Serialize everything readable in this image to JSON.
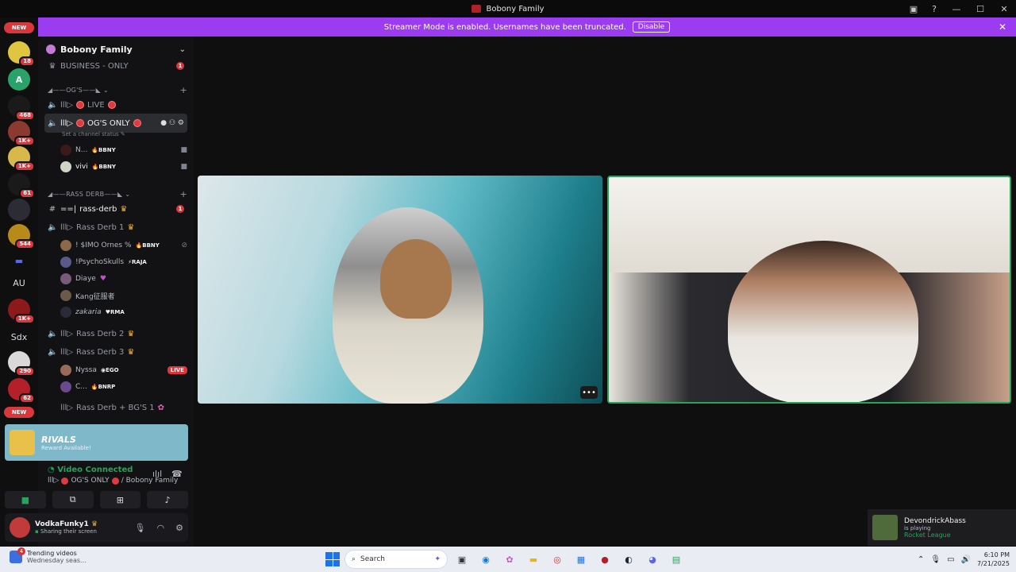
{
  "window": {
    "title": "Bobony Family"
  },
  "banner": {
    "text": "Streamer Mode is enabled. Usernames have been truncated.",
    "disable_label": "Disable"
  },
  "rail": {
    "new_top": "NEW",
    "new_bottom": "NEW",
    "badges": [
      "18",
      "468",
      "1K+",
      "1K+",
      "61",
      "544",
      "1K+",
      "290",
      "62"
    ],
    "text_servers": [
      "AU",
      "Sdx"
    ]
  },
  "server": {
    "name": "Bobony Family"
  },
  "channels": {
    "business": "BUSINESS - ONLY",
    "business_badge": "1",
    "cat_ogs": "OG'S",
    "live": "LIVE",
    "ogs_only": "OG'S ONLY",
    "set_status": "Set a channel status",
    "cat_rass": "RASS DERB",
    "rass_derb_text": "rass-derb",
    "rass_badge": "1",
    "rass1": "Rass Derb 1",
    "rass2": "Rass Derb 2",
    "rass3": "Rass Derb 3",
    "rass_bgs": "Rass Derb + BG'S 1"
  },
  "voice_users": [
    {
      "name": "N...",
      "tag": "BBNY"
    },
    {
      "name": "vivi",
      "tag": "BBNY"
    },
    {
      "name": "! $IMO Ornes %",
      "tag": "BBNY"
    },
    {
      "name": "!PsychoSkulls",
      "tag": "RAJA"
    },
    {
      "name": "Diaye",
      "tag": ""
    },
    {
      "name": "Kang征服者",
      "tag": ""
    },
    {
      "name": "zakaria",
      "tag": "RMA"
    },
    {
      "name": "Nyssa",
      "tag": "EGO",
      "live": "LIVE"
    },
    {
      "name": "C...",
      "tag": "BNRP"
    }
  ],
  "promo": {
    "title": "RIVALS",
    "sub": "Reward Available!"
  },
  "voice_panel": {
    "status": "Video Connected",
    "channel": "OG'S ONLY",
    "server": "/ Bobony Family"
  },
  "user_panel": {
    "name": "VodkaFunky1",
    "status": "Sharing their screen"
  },
  "notification": {
    "name": "DevondrickAbass",
    "line2": "is playing",
    "game": "Rocket League"
  },
  "taskbar": {
    "widget_title": "Trending videos",
    "widget_sub": "Wednesday seas...",
    "widget_badge": "4",
    "search": "Search",
    "time": "6:10 PM",
    "date": "7/21/2025"
  },
  "colors": {
    "banner": "#9b3cf0",
    "accent_green": "#23a55a",
    "badge_red": "#da373c"
  }
}
